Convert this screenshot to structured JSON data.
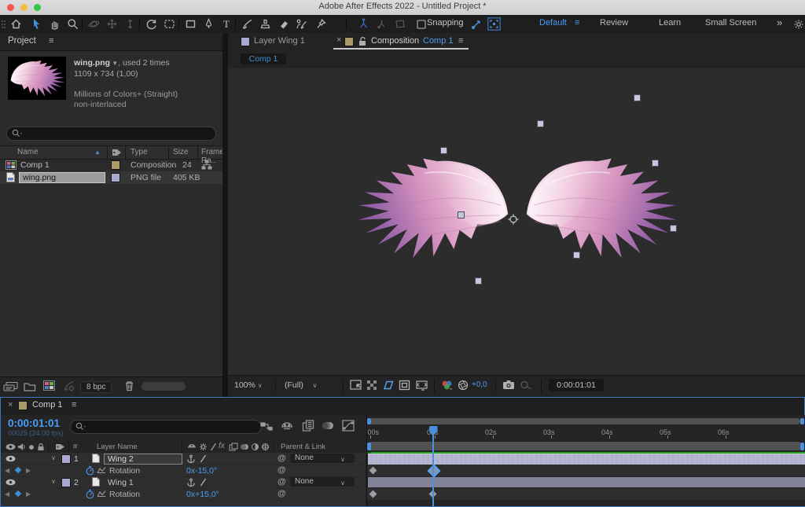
{
  "window": {
    "title": "Adobe After Effects 2022 - Untitled Project *"
  },
  "toolbar": {
    "snapping_label": "Snapping",
    "workspaces": [
      "Default",
      "Review",
      "Learn",
      "Small Screen"
    ],
    "active_workspace": "Default",
    "more_chevron": "»"
  },
  "project": {
    "tab": "Project",
    "file": {
      "name": "wing.png",
      "usage": ", used 2 times",
      "dims": "1109 x 734 (1,00)",
      "colors": "Millions of Colors+ (Straight)",
      "interlace": "non-interlaced"
    },
    "columns": {
      "name": "Name",
      "type": "Type",
      "size": "Size",
      "frame_rate": "Frame Ra.."
    },
    "rows": [
      {
        "name": "Comp 1",
        "type": "Composition",
        "size": "",
        "frame_rate": "24"
      },
      {
        "name": "wing.png",
        "type": "PNG file",
        "size": "405 KB",
        "frame_rate": ""
      }
    ],
    "bit_depth": "8 bpc"
  },
  "viewer": {
    "layer_tab": "Layer Wing 1",
    "comp_tab_prefix": "Composition",
    "comp_tab_name": "Comp 1",
    "close_glyph": "×",
    "breadcrumb": "Comp 1",
    "zoom": "100%",
    "resolution": "(Full)",
    "exposure": "+0,0",
    "timecode": "0:00:01:01"
  },
  "timeline": {
    "tab": "Comp 1",
    "close_glyph": "×",
    "timecode": "0:00:01:01",
    "frame_info": "00025 (24.00 fps)",
    "header": {
      "number": "#",
      "layer_name": "Layer Name",
      "parent": "Parent & Link"
    },
    "layers": [
      {
        "num": "1",
        "name": "Wing 2",
        "parent": "None",
        "property": "Rotation",
        "value": "0x-15,0°"
      },
      {
        "num": "2",
        "name": "Wing 1",
        "parent": "None",
        "property": "Rotation",
        "value": "0x+15,0°"
      }
    ],
    "ruler": [
      "0:00s",
      "01s",
      "02s",
      "03s",
      "04s",
      "05s",
      "06s"
    ]
  },
  "colors": {
    "accent_blue": "#4a9df8",
    "label_tan": "#ab9b6b",
    "label_lavender": "#a9a9cf",
    "cache_green": "#21a621",
    "bar_selected": "#b7b7d2",
    "bar_unselected": "#83839a",
    "keyframe_outline": "#57a3f0"
  }
}
